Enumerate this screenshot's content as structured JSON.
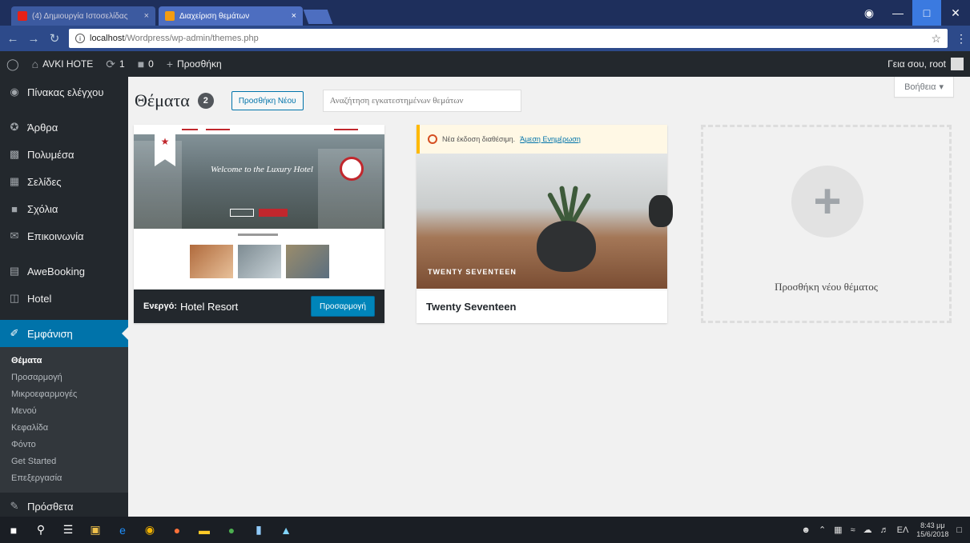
{
  "browser": {
    "tabs": [
      {
        "label": "(4) Δημιουργία Ιστοσελίδας",
        "close": "×"
      },
      {
        "label": "Διαχείριση θεμάτων",
        "close": "×"
      }
    ],
    "url_host": "localhost",
    "url_path": "/Wordpress/wp-admin/themes.php"
  },
  "adminbar": {
    "site_name": "AVKI HOTE",
    "updates_count": "1",
    "comments_count": "0",
    "new_label": "Προσθήκη",
    "greeting": "Γεια σου, root"
  },
  "sidebar": {
    "items": [
      {
        "icon": "dashboard-icon",
        "label": "Πίνακας ελέγχου"
      },
      {
        "icon": "pin-icon",
        "label": "Άρθρα"
      },
      {
        "icon": "media-icon",
        "label": "Πολυμέσα"
      },
      {
        "icon": "pages-icon",
        "label": "Σελίδες"
      },
      {
        "icon": "comments-icon",
        "label": "Σχόλια"
      },
      {
        "icon": "contact-icon",
        "label": "Επικοινωνία"
      },
      {
        "icon": "calendar-icon",
        "label": "AweBooking"
      },
      {
        "icon": "hotel-icon",
        "label": "Hotel"
      },
      {
        "icon": "appearance-icon",
        "label": "Εμφάνιση"
      }
    ],
    "submenu": [
      "Θέματα",
      "Προσαρμογή",
      "Μικροεφαρμογές",
      "Μενού",
      "Κεφαλίδα",
      "Φόντο",
      "Get Started",
      "Επεξεργασία"
    ],
    "plugins_label": "Πρόσθετα"
  },
  "main": {
    "help_label": "Βοήθεια",
    "title": "Θέματα",
    "count": "2",
    "add_new_label": "Προσθήκη Νέου",
    "search_placeholder": "Αναζήτηση εγκατεστημένων θεμάτων",
    "active_theme": {
      "active_label": "Ενεργό:",
      "name": "Hotel Resort",
      "customize_label": "Προσαρμογή",
      "welcome_text": "Welcome to the Luxury Hotel"
    },
    "second_theme": {
      "name": "Twenty Seventeen",
      "update_text": "Νέα έκδοση διαθέσιμη.",
      "update_link": "Άμεση Ενημέρωση",
      "shot_title": "TWENTY SEVENTEEN"
    },
    "add_new_theme_label": "Προσθήκη νέου θέματος"
  },
  "taskbar": {
    "tray_lang": "ΕΛ",
    "time": "8:43 μμ",
    "date": "15/6/2018"
  }
}
